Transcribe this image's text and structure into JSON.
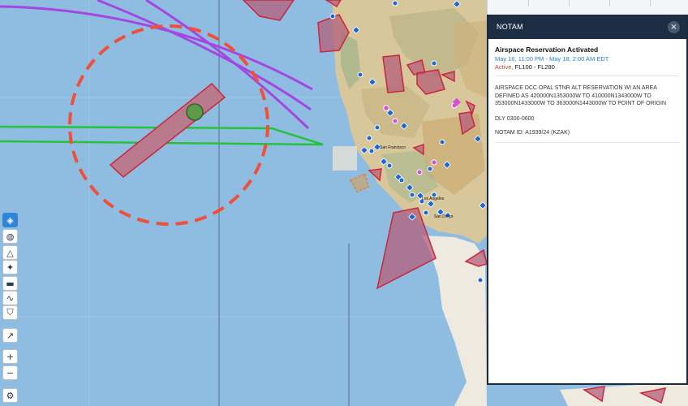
{
  "notam_panel": {
    "header_title": "NOTAM",
    "close_icon": "×",
    "notice_title": "Airspace Reservation Activated",
    "time_range": "May 16, 11:00 PM - May 18, 2:00 AM EDT",
    "status_active": "Active,",
    "altitude_range": "FL100 - FL280",
    "body_text": "AIRSPACE DCC OPAL STNR ALT RESERVATION WI AN AREA DEFINED AS 420000N1353000W TO 410000N1343000W TO 353000N1433000W TO 363000N1443000W TO POINT OF ORIGIN",
    "schedule": "DLY 0300-0600",
    "notam_id": "NOTAM ID: A1939/24 (KZAK)"
  },
  "map_labels": {
    "san_francisco": "San Francisco",
    "los_angeles": "Los Angeles",
    "san_diego": "San Diego"
  },
  "toolbar": {
    "items": [
      "layers-icon",
      "weather-icon",
      "terrain-icon",
      "traffic-icon",
      "airport-icon",
      "route-icon",
      "shield-icon",
      "draw-icon",
      "zoom-in-icon",
      "zoom-out-icon",
      "settings-icon"
    ]
  },
  "colors": {
    "ocean": "#8fbde2",
    "restricted_fill": "#b45f7a",
    "restricted_stroke": "#c9283c",
    "route_purple": "#a347e0",
    "route_green": "#27c23a",
    "notam_circle": "#f0503a",
    "airport_blue": "#1f67d6",
    "panel_header": "#1d2d44"
  }
}
